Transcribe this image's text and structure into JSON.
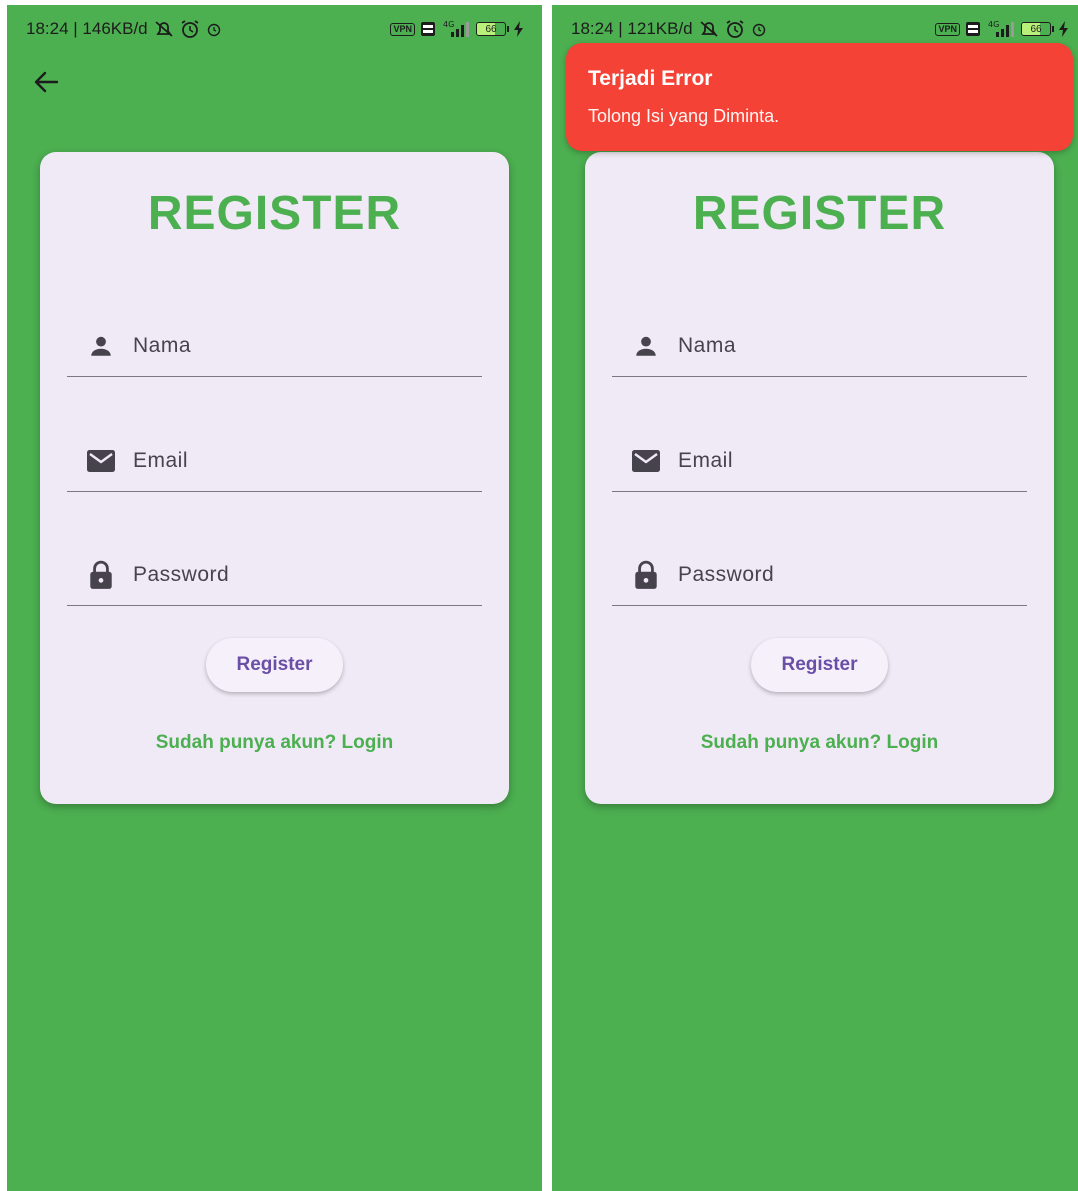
{
  "screens": [
    {
      "status": {
        "time_speed": "18:24 | 146KB/d",
        "vpn": "VPN",
        "battery_level": "66",
        "battery_fraction": 0.66
      },
      "back_icon": "arrow-left-icon",
      "form": {
        "title": "REGISTER",
        "name_placeholder": "Nama",
        "email_placeholder": "Email",
        "password_placeholder": "Password",
        "register_label": "Register",
        "login_link": "Sudah punya akun? Login"
      }
    },
    {
      "status": {
        "time_speed": "18:24 | 121KB/d",
        "vpn": "VPN",
        "battery_level": "66",
        "battery_fraction": 0.66
      },
      "toast": {
        "title": "Terjadi Error",
        "message": "Tolong Isi yang Diminta."
      },
      "form": {
        "title": "REGISTER",
        "name_placeholder": "Nama",
        "email_placeholder": "Email",
        "password_placeholder": "Password",
        "register_label": "Register",
        "login_link": "Sudah punya akun? Login"
      }
    }
  ],
  "colors": {
    "background": "#4caf50",
    "card": "#f0eaf6",
    "accent_green": "#4caf50",
    "button_text": "#6a4fa6",
    "error": "#f44336"
  },
  "icons": [
    "person-icon",
    "mail-icon",
    "lock-icon",
    "arrow-left-icon",
    "wifi-off-icon",
    "alarm-icon",
    "signal-icon",
    "battery-icon",
    "charging-icon"
  ]
}
